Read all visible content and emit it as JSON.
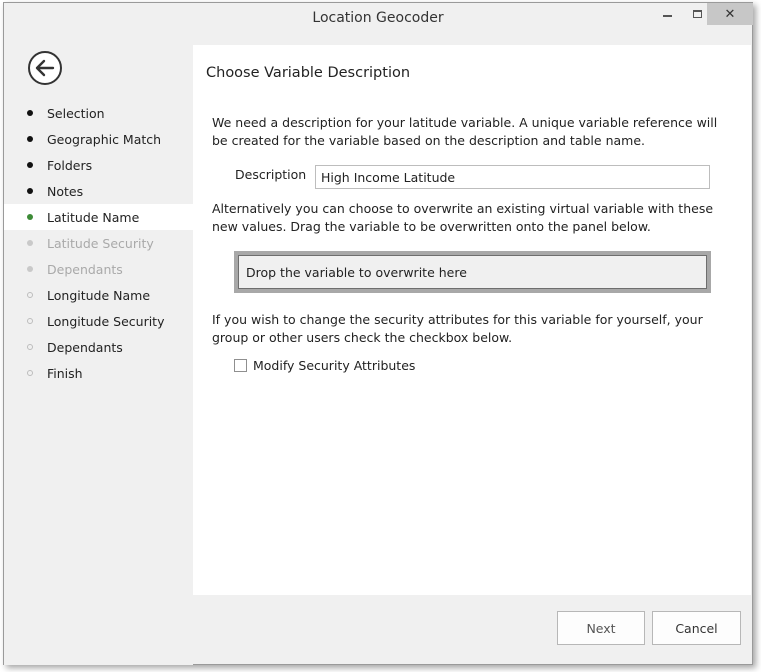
{
  "window": {
    "title": "Location Geocoder",
    "close_glyph": "✕"
  },
  "sidebar": {
    "items": [
      {
        "label": "Selection",
        "state": "done"
      },
      {
        "label": "Geographic Match",
        "state": "done"
      },
      {
        "label": "Folders",
        "state": "done"
      },
      {
        "label": "Notes",
        "state": "done"
      },
      {
        "label": "Latitude Name",
        "state": "active"
      },
      {
        "label": "Latitude Security",
        "state": "pending"
      },
      {
        "label": "Dependants",
        "state": "pending"
      },
      {
        "label": "Longitude Name",
        "state": "empty"
      },
      {
        "label": "Longitude Security",
        "state": "empty"
      },
      {
        "label": "Dependants",
        "state": "empty"
      },
      {
        "label": "Finish",
        "state": "empty"
      }
    ]
  },
  "panel": {
    "title": "Choose Variable Description",
    "intro": "We need a description for your latitude variable.  A unique variable reference will be created for the variable based on the description and table name.",
    "description_label": "Description",
    "description_value": "High Income Latitude",
    "overwrite_text": "Alternatively you can choose to overwrite an existing virtual variable with these new values. Drag the variable to be overwritten onto the panel below.",
    "drop_text": "Drop the variable to overwrite here",
    "security_text": "If you wish to change the security attributes for this variable for yourself, your group or other users check the checkbox below.",
    "checkbox_label": "Modify Security Attributes",
    "checkbox_checked": false
  },
  "footer": {
    "next_label": "Next",
    "cancel_label": "Cancel"
  },
  "colors": {
    "active_dot": "#3d8b37",
    "panel_bg": "#ffffff",
    "chrome_bg": "#f0f0f0"
  }
}
